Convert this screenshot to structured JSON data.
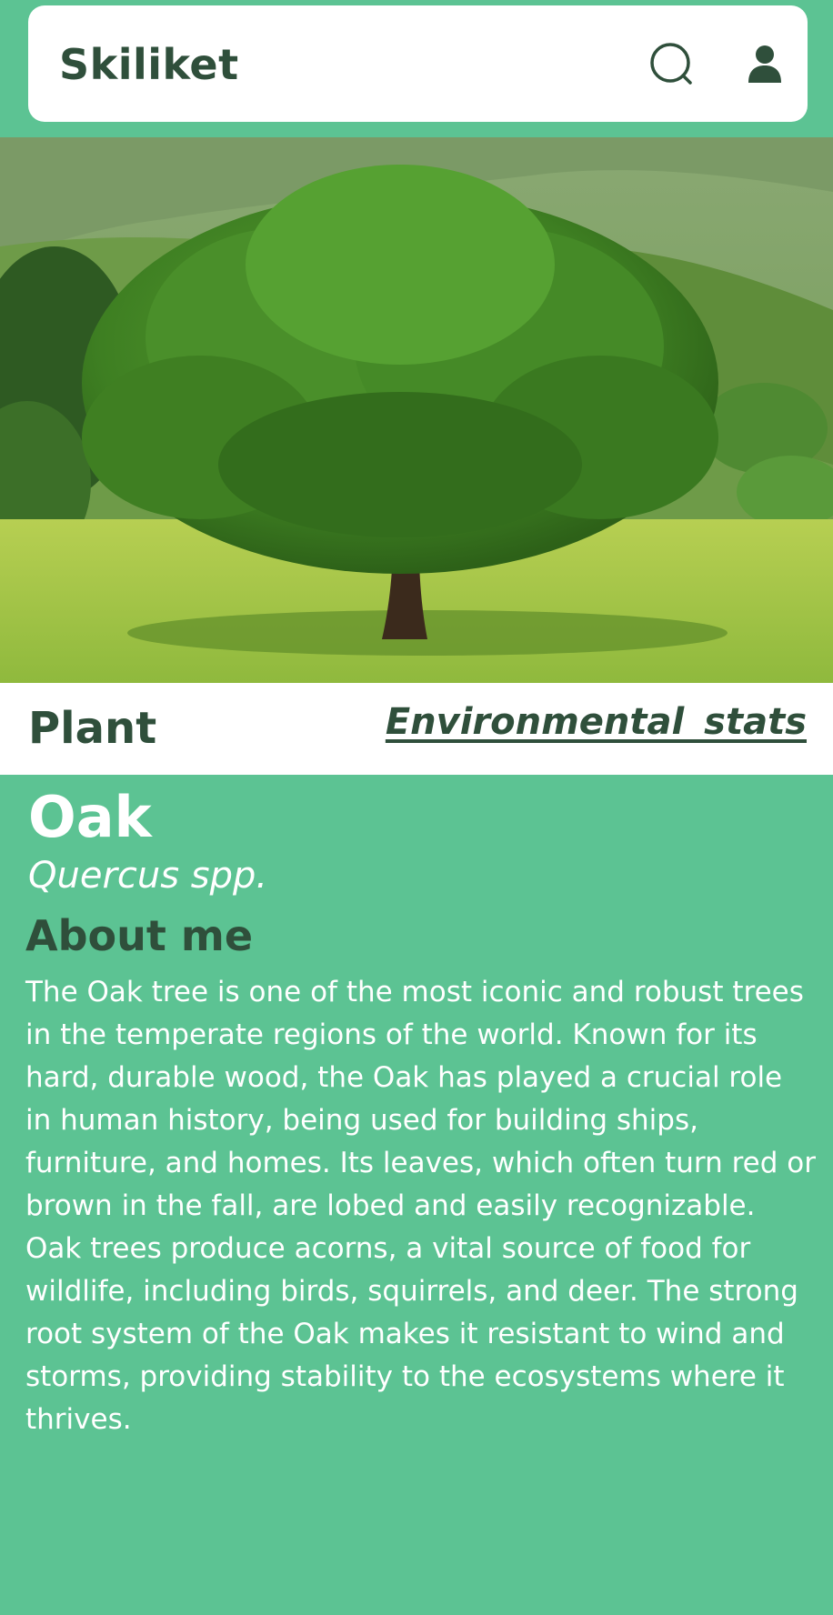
{
  "header": {
    "app_title": "Skiliket",
    "search_icon": "search-icon",
    "profile_icon": "user-icon"
  },
  "hero": {
    "image_subject": "Oak tree in a green meadow"
  },
  "tabs": {
    "category_label": "Plant",
    "stats_link_label": "Environmental  stats"
  },
  "plant": {
    "name": "Oak",
    "scientific_name": "Quercus spp.",
    "about_title": "About me",
    "about_text": "The Oak tree is one of the most iconic and robust trees in the temperate regions of the world. Known for its hard, durable wood, the Oak has played a crucial role in human history, being used for building ships, furniture, and homes. Its leaves, which often turn red or brown in the fall, are lobed and easily recognizable. Oak trees produce acorns, a vital source of food for wildlife, including birds, squirrels, and deer. The strong root system of the Oak makes it resistant to wind and storms, providing stability to the ecosystems where it thrives."
  },
  "colors": {
    "background": "#5cc393",
    "dark_text": "#2f4f3b",
    "card": "#ffffff"
  }
}
